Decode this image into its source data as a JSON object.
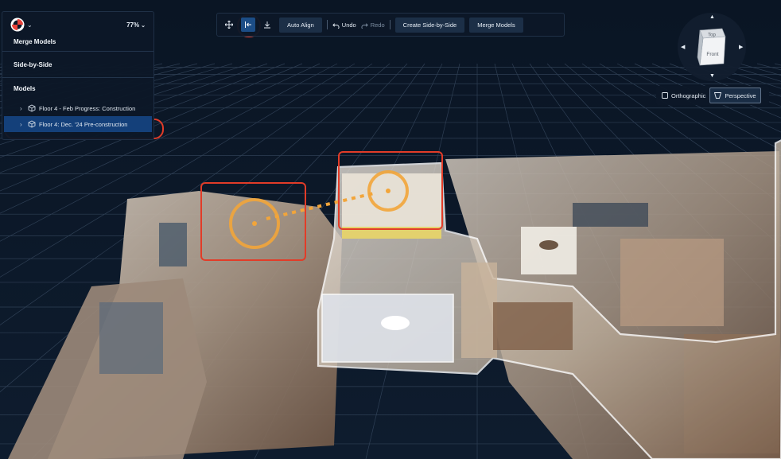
{
  "header": {
    "logo_icon": "matterport-logo-icon",
    "zoom_level": "77%"
  },
  "sidebar": {
    "merge_title": "Merge Models",
    "side_by_side_title": "Side-by-Side",
    "models_title": "Models",
    "models": [
      {
        "label": "Floor 4 - Feb Progress: Construction",
        "selected": false
      },
      {
        "label": "Floor 4: Dec. '24 Pre-construction",
        "selected": true
      }
    ]
  },
  "toolbar": {
    "move_icon": "move-icon",
    "align_start_icon": "align-start-icon",
    "download_icon": "download-icon",
    "auto_align_label": "Auto Align",
    "undo_label": "Undo",
    "redo_label": "Redo",
    "create_sbs_label": "Create Side-by-Side",
    "merge_models_label": "Merge Models"
  },
  "nav_cube": {
    "top_label": "Top",
    "front_label": "Front"
  },
  "view_mode": {
    "orthographic_label": "Orthographic",
    "perspective_label": "Perspective",
    "selected": "Perspective"
  },
  "colors": {
    "accent_blue": "#14407a",
    "highlight_red": "#e23c28",
    "marker_orange": "#f2a53a",
    "background": "#0b1626"
  }
}
